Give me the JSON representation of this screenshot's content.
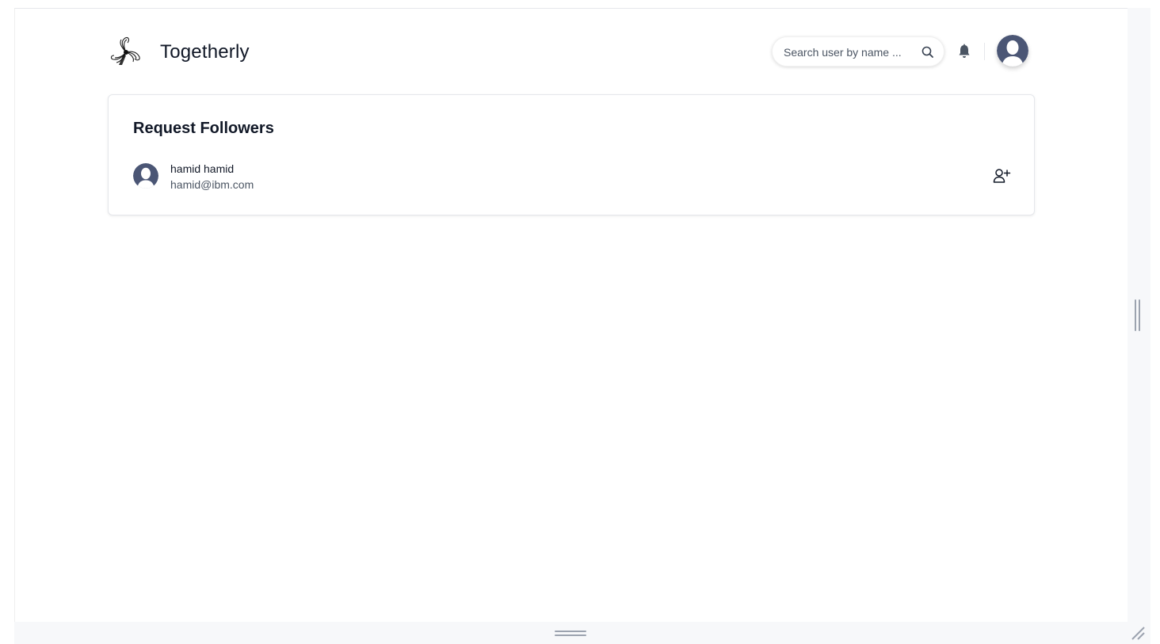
{
  "header": {
    "app_title": "Togetherly",
    "logo_icon": "swirl-logo-icon",
    "search": {
      "placeholder": "Search user by name ...",
      "value": "",
      "icon": "search-icon"
    },
    "notifications_icon": "bell-icon",
    "avatar_icon": "user-avatar-icon"
  },
  "card": {
    "title": "Request Followers",
    "followers": [
      {
        "name": "hamid hamid",
        "email": "hamid@ibm.com",
        "avatar_icon": "user-avatar-icon",
        "action_icon": "user-plus-icon"
      }
    ]
  },
  "colors": {
    "avatar_bg": "#4b5675",
    "text": "#111827",
    "muted_text": "#4b5563",
    "gutter": "#f7f8fa"
  }
}
